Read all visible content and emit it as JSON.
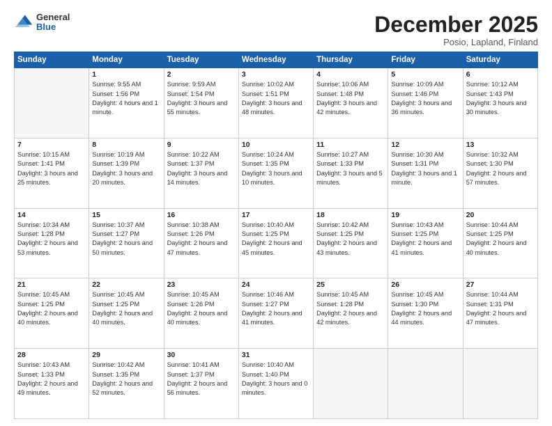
{
  "logo": {
    "general": "General",
    "blue": "Blue"
  },
  "header": {
    "month": "December 2025",
    "location": "Posio, Lapland, Finland"
  },
  "weekdays": [
    "Sunday",
    "Monday",
    "Tuesday",
    "Wednesday",
    "Thursday",
    "Friday",
    "Saturday"
  ],
  "weeks": [
    [
      {
        "day": null
      },
      {
        "day": "1",
        "sunrise": "9:55 AM",
        "sunset": "1:56 PM",
        "daylight": "4 hours and 1 minute."
      },
      {
        "day": "2",
        "sunrise": "9:59 AM",
        "sunset": "1:54 PM",
        "daylight": "3 hours and 55 minutes."
      },
      {
        "day": "3",
        "sunrise": "10:02 AM",
        "sunset": "1:51 PM",
        "daylight": "3 hours and 48 minutes."
      },
      {
        "day": "4",
        "sunrise": "10:06 AM",
        "sunset": "1:48 PM",
        "daylight": "3 hours and 42 minutes."
      },
      {
        "day": "5",
        "sunrise": "10:09 AM",
        "sunset": "1:46 PM",
        "daylight": "3 hours and 36 minutes."
      },
      {
        "day": "6",
        "sunrise": "10:12 AM",
        "sunset": "1:43 PM",
        "daylight": "3 hours and 30 minutes."
      }
    ],
    [
      {
        "day": "7",
        "sunrise": "10:15 AM",
        "sunset": "1:41 PM",
        "daylight": "3 hours and 25 minutes."
      },
      {
        "day": "8",
        "sunrise": "10:19 AM",
        "sunset": "1:39 PM",
        "daylight": "3 hours and 20 minutes."
      },
      {
        "day": "9",
        "sunrise": "10:22 AM",
        "sunset": "1:37 PM",
        "daylight": "3 hours and 14 minutes."
      },
      {
        "day": "10",
        "sunrise": "10:24 AM",
        "sunset": "1:35 PM",
        "daylight": "3 hours and 10 minutes."
      },
      {
        "day": "11",
        "sunrise": "10:27 AM",
        "sunset": "1:33 PM",
        "daylight": "3 hours and 5 minutes."
      },
      {
        "day": "12",
        "sunrise": "10:30 AM",
        "sunset": "1:31 PM",
        "daylight": "3 hours and 1 minute."
      },
      {
        "day": "13",
        "sunrise": "10:32 AM",
        "sunset": "1:30 PM",
        "daylight": "2 hours and 57 minutes."
      }
    ],
    [
      {
        "day": "14",
        "sunrise": "10:34 AM",
        "sunset": "1:28 PM",
        "daylight": "2 hours and 53 minutes."
      },
      {
        "day": "15",
        "sunrise": "10:37 AM",
        "sunset": "1:27 PM",
        "daylight": "2 hours and 50 minutes."
      },
      {
        "day": "16",
        "sunrise": "10:38 AM",
        "sunset": "1:26 PM",
        "daylight": "2 hours and 47 minutes."
      },
      {
        "day": "17",
        "sunrise": "10:40 AM",
        "sunset": "1:25 PM",
        "daylight": "2 hours and 45 minutes."
      },
      {
        "day": "18",
        "sunrise": "10:42 AM",
        "sunset": "1:25 PM",
        "daylight": "2 hours and 43 minutes."
      },
      {
        "day": "19",
        "sunrise": "10:43 AM",
        "sunset": "1:25 PM",
        "daylight": "2 hours and 41 minutes."
      },
      {
        "day": "20",
        "sunrise": "10:44 AM",
        "sunset": "1:25 PM",
        "daylight": "2 hours and 40 minutes."
      }
    ],
    [
      {
        "day": "21",
        "sunrise": "10:45 AM",
        "sunset": "1:25 PM",
        "daylight": "2 hours and 40 minutes."
      },
      {
        "day": "22",
        "sunrise": "10:45 AM",
        "sunset": "1:25 PM",
        "daylight": "2 hours and 40 minutes."
      },
      {
        "day": "23",
        "sunrise": "10:45 AM",
        "sunset": "1:26 PM",
        "daylight": "2 hours and 40 minutes."
      },
      {
        "day": "24",
        "sunrise": "10:46 AM",
        "sunset": "1:27 PM",
        "daylight": "2 hours and 41 minutes."
      },
      {
        "day": "25",
        "sunrise": "10:45 AM",
        "sunset": "1:28 PM",
        "daylight": "2 hours and 42 minutes."
      },
      {
        "day": "26",
        "sunrise": "10:45 AM",
        "sunset": "1:30 PM",
        "daylight": "2 hours and 44 minutes."
      },
      {
        "day": "27",
        "sunrise": "10:44 AM",
        "sunset": "1:31 PM",
        "daylight": "2 hours and 47 minutes."
      }
    ],
    [
      {
        "day": "28",
        "sunrise": "10:43 AM",
        "sunset": "1:33 PM",
        "daylight": "2 hours and 49 minutes."
      },
      {
        "day": "29",
        "sunrise": "10:42 AM",
        "sunset": "1:35 PM",
        "daylight": "2 hours and 52 minutes."
      },
      {
        "day": "30",
        "sunrise": "10:41 AM",
        "sunset": "1:37 PM",
        "daylight": "2 hours and 56 minutes."
      },
      {
        "day": "31",
        "sunrise": "10:40 AM",
        "sunset": "1:40 PM",
        "daylight": "3 hours and 0 minutes."
      },
      {
        "day": null
      },
      {
        "day": null
      },
      {
        "day": null
      }
    ]
  ]
}
